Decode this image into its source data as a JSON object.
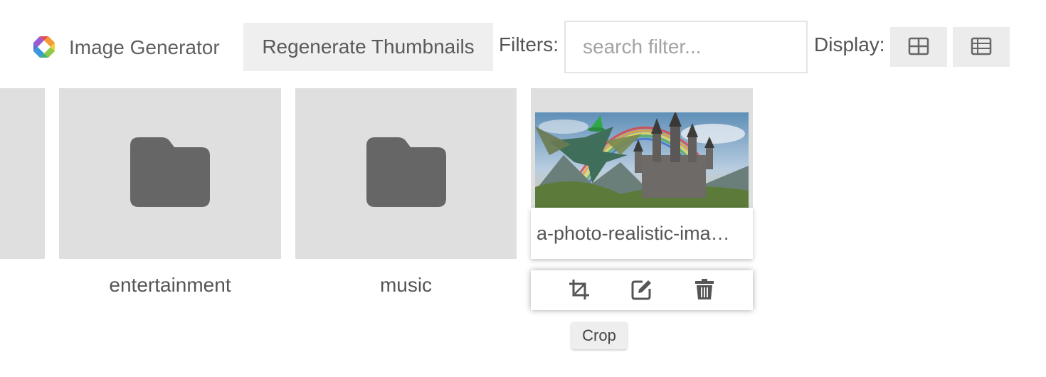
{
  "app": {
    "title": "Image Generator",
    "logo_icon": "multicolor-octagon-logo"
  },
  "toolbar": {
    "regenerate_label": "Regenerate Thumbnails",
    "filters_label": "Filters:",
    "search_placeholder": "search filter...",
    "search_value": "",
    "display_label": "Display:",
    "view_grid_icon": "grid-view-icon",
    "view_list_icon": "list-view-icon"
  },
  "folders": [
    {
      "name": "entertainment",
      "icon": "folder-icon"
    },
    {
      "name": "music",
      "icon": "folder-icon"
    }
  ],
  "image_item": {
    "name": "a-photo-realistic-ima…",
    "thumbnail": "dragon-with-wizard-hat-flying-near-castle-with-rainbow"
  },
  "actions": [
    {
      "icon": "crop-icon"
    },
    {
      "icon": "edit-icon"
    },
    {
      "icon": "trash-icon"
    }
  ],
  "tooltip": {
    "text": "Crop"
  },
  "colors": {
    "tile_bg": "#dfdfdf",
    "folder_icon": "#666666",
    "button_bg": "#efefef",
    "text": "#555555"
  }
}
